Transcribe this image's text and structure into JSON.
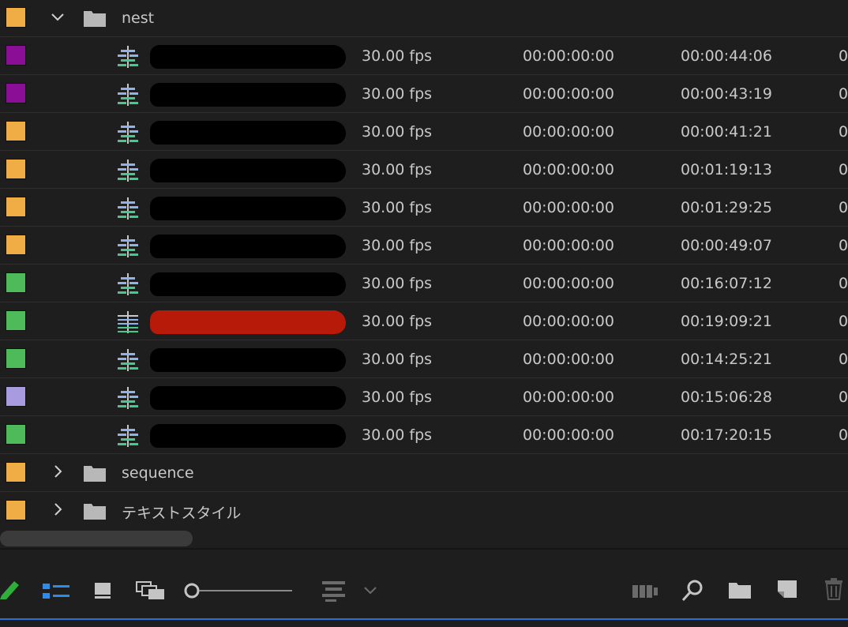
{
  "folders": {
    "nest": {
      "name": "nest",
      "color": "#f0ac45",
      "expanded": true
    },
    "sequence": {
      "name": "sequence",
      "color": "#f0ac45",
      "expanded": false
    },
    "text_style": {
      "name": "テキストスタイル",
      "color": "#f0ac45",
      "expanded": false
    }
  },
  "rows": [
    {
      "color": "#8a0f96",
      "redaction": "#000000",
      "fps": "30.00 fps",
      "media_start": "00:00:00:00",
      "media_end": "00:00:44:06",
      "icon": "sequence-icon"
    },
    {
      "color": "#8a0f96",
      "redaction": "#000000",
      "fps": "30.00 fps",
      "media_start": "00:00:00:00",
      "media_end": "00:00:43:19",
      "icon": "sequence-icon"
    },
    {
      "color": "#f0ac45",
      "redaction": "#000000",
      "fps": "30.00 fps",
      "media_start": "00:00:00:00",
      "media_end": "00:00:41:21",
      "icon": "sequence-icon"
    },
    {
      "color": "#f0ac45",
      "redaction": "#000000",
      "fps": "30.00 fps",
      "media_start": "00:00:00:00",
      "media_end": "00:01:19:13",
      "icon": "sequence-icon"
    },
    {
      "color": "#f0ac45",
      "redaction": "#000000",
      "fps": "30.00 fps",
      "media_start": "00:00:00:00",
      "media_end": "00:01:29:25",
      "icon": "sequence-icon"
    },
    {
      "color": "#f0ac45",
      "redaction": "#000000",
      "fps": "30.00 fps",
      "media_start": "00:00:00:00",
      "media_end": "00:00:49:07",
      "icon": "sequence-icon"
    },
    {
      "color": "#4fba5a",
      "redaction": "#000000",
      "fps": "30.00 fps",
      "media_start": "00:00:00:00",
      "media_end": "00:16:07:12",
      "icon": "sequence-icon"
    },
    {
      "color": "#4fba5a",
      "redaction": "#b81a0a",
      "fps": "30.00 fps",
      "media_start": "00:00:00:00",
      "media_end": "00:19:09:21",
      "icon": "multicam-sequence-icon"
    },
    {
      "color": "#4fba5a",
      "redaction": "#000000",
      "fps": "30.00 fps",
      "media_start": "00:00:00:00",
      "media_end": "00:14:25:21",
      "icon": "sequence-icon"
    },
    {
      "color": "#a89be0",
      "redaction": "#000000",
      "fps": "30.00 fps",
      "media_start": "00:00:00:00",
      "media_end": "00:15:06:28",
      "icon": "sequence-icon"
    },
    {
      "color": "#4fba5a",
      "redaction": "#000000",
      "fps": "30.00 fps",
      "media_start": "00:00:00:00",
      "media_end": "00:17:20:15",
      "icon": "sequence-icon"
    }
  ],
  "toolbar": {
    "accent": "#2d6fd6",
    "icons": [
      "pencil-icon",
      "list-view-icon",
      "icon-view-icon",
      "freeform-view-icon",
      "zoom-slider",
      "sort-icons-icon",
      "automate-to-sequence-icon",
      "find-icon",
      "new-bin-icon",
      "new-item-icon",
      "clear-icon"
    ]
  }
}
